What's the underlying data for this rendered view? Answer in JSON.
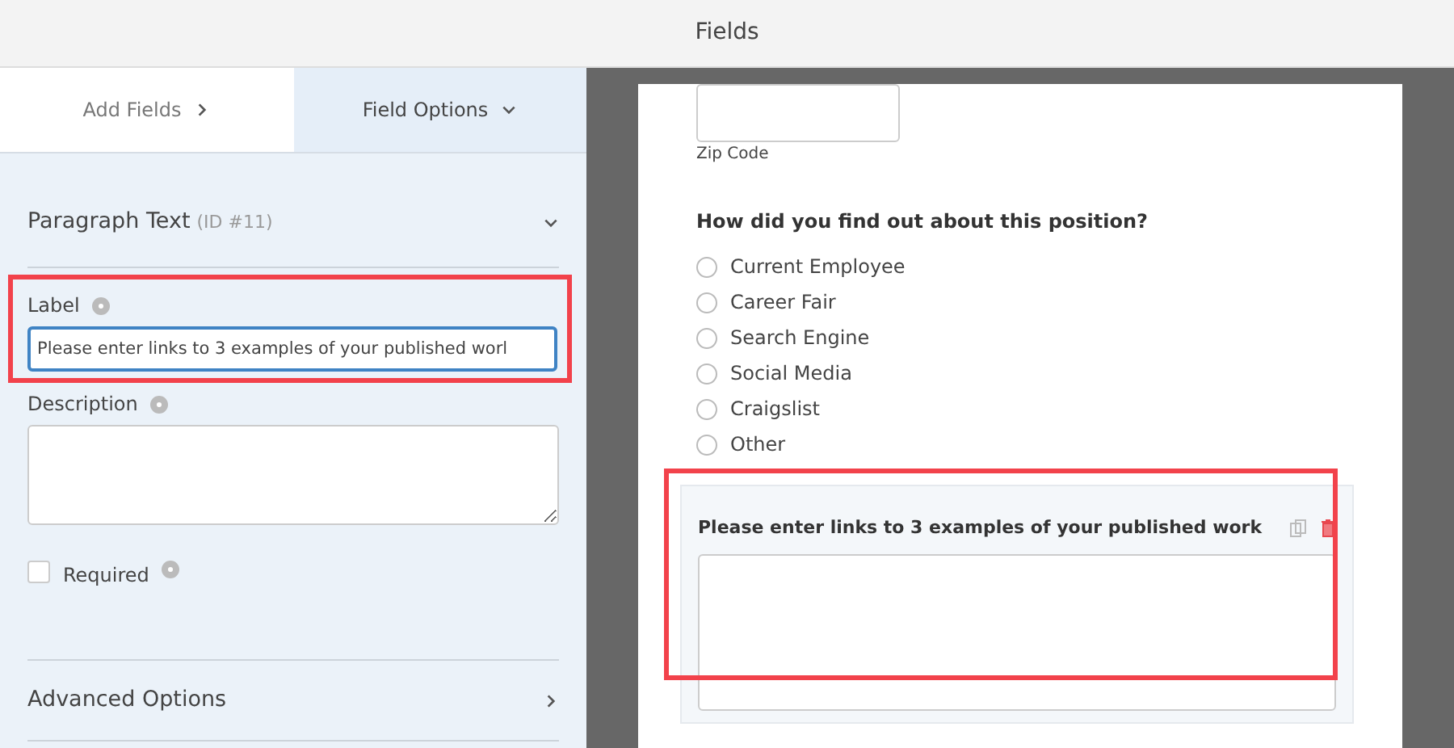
{
  "header": {
    "title": "Fields"
  },
  "tabs": [
    {
      "label": "Add Fields",
      "selected": false
    },
    {
      "label": "Field Options",
      "selected": true
    }
  ],
  "field_options": {
    "title": "Paragraph Text",
    "id_label": "(ID #11)",
    "expanded": true,
    "label_field": {
      "label": "Label",
      "value": "Please enter links to 3 examples of your published worl"
    },
    "description_field": {
      "label": "Description"
    },
    "required": {
      "label": "Required",
      "checked": false
    },
    "advanced": {
      "label": "Advanced Options",
      "expanded": false
    }
  },
  "form_preview": {
    "zip_label": "Zip Code",
    "question": "How did you find out about this position?",
    "options": [
      {
        "label": "Current Employee",
        "selected": false
      },
      {
        "label": "Career Fair",
        "selected": false
      },
      {
        "label": "Search Engine",
        "selected": false
      },
      {
        "label": "Social Media",
        "selected": false
      },
      {
        "label": "Craigslist",
        "selected": false
      },
      {
        "label": "Other",
        "selected": false
      }
    ],
    "selected_field": {
      "label": "Please enter links to 3 examples of your published work"
    }
  }
}
